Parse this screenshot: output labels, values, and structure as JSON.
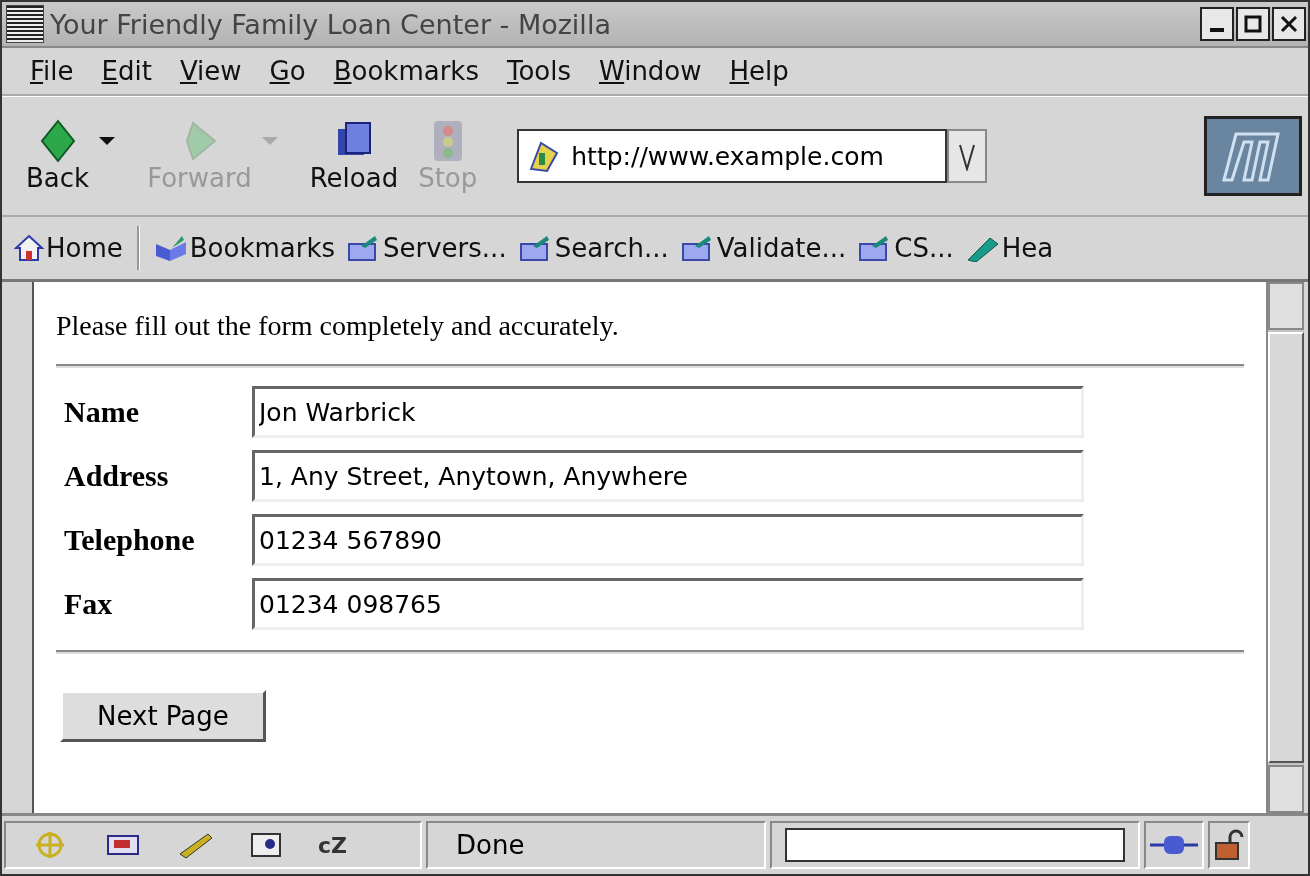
{
  "window": {
    "title": "Your Friendly Family Loan Center - Mozilla"
  },
  "menu": [
    "File",
    "Edit",
    "View",
    "Go",
    "Bookmarks",
    "Tools",
    "Window",
    "Help"
  ],
  "toolbar": [
    {
      "kind": "back",
      "label": "Back",
      "disabled": false,
      "dropdown": true
    },
    {
      "kind": "forward",
      "label": "Forward",
      "disabled": true,
      "dropdown": true
    },
    {
      "kind": "reload",
      "label": "Reload",
      "disabled": false,
      "dropdown": false
    },
    {
      "kind": "stop",
      "label": "Stop",
      "disabled": true,
      "dropdown": false
    }
  ],
  "url": "http://www.example.com",
  "bookmarks": [
    {
      "kind": "home",
      "label": "Home"
    },
    {
      "kind": "bookmarks",
      "label": "Bookmarks"
    },
    {
      "kind": "folder",
      "label": "Servers..."
    },
    {
      "kind": "folder",
      "label": "Search..."
    },
    {
      "kind": "folder",
      "label": "Validate..."
    },
    {
      "kind": "folder",
      "label": "CS..."
    },
    {
      "kind": "pen",
      "label": "Hea"
    }
  ],
  "page": {
    "intro": "Please fill out the form completely and accurately.",
    "fields": [
      {
        "label": "Name",
        "value": "Jon Warbrick"
      },
      {
        "label": "Address",
        "value": "1, Any Street, Anytown, Anywhere"
      },
      {
        "label": "Telephone",
        "value": "01234 567890"
      },
      {
        "label": "Fax",
        "value": "01234 098765"
      }
    ],
    "button": "Next Page"
  },
  "status_bar": {
    "component_text": "cZ",
    "status": "Done"
  }
}
